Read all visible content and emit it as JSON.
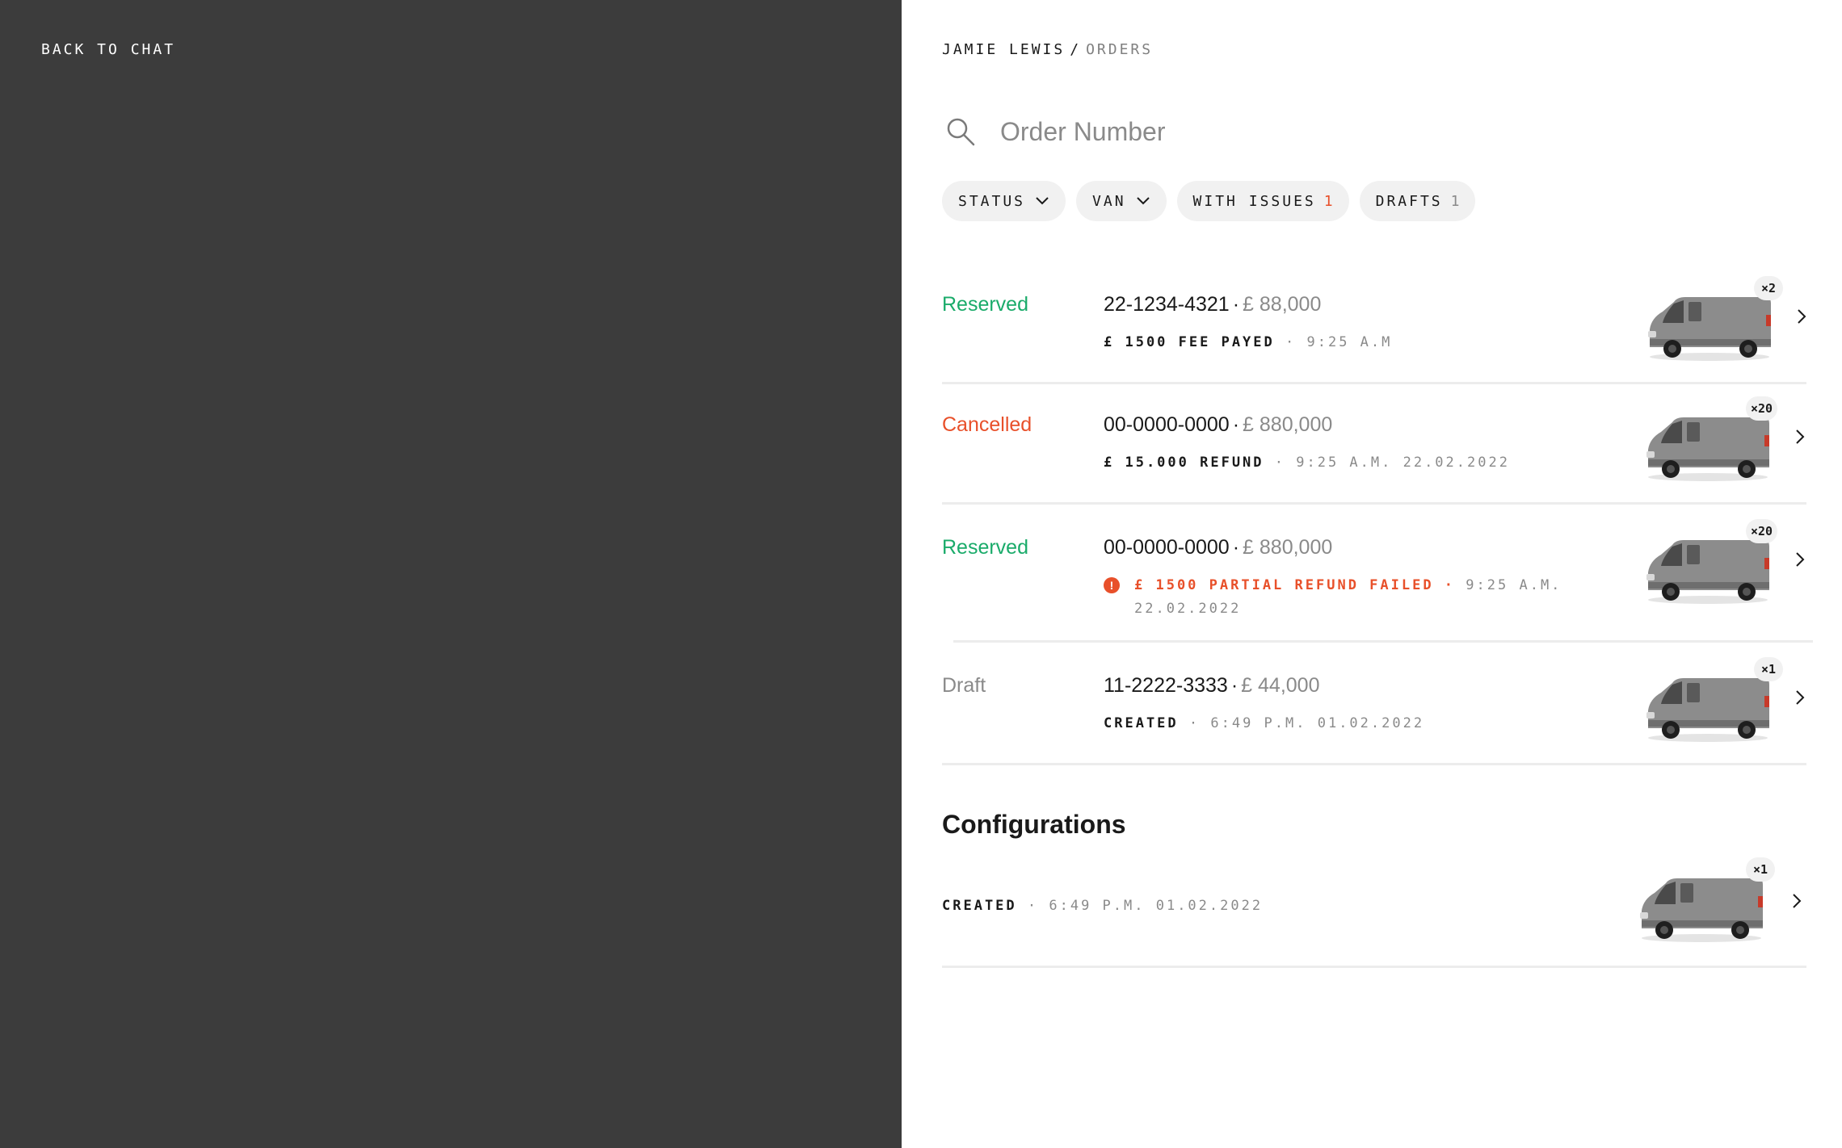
{
  "left": {
    "back_label": "BACK TO CHAT"
  },
  "breadcrumb": {
    "user": "JAMIE LEWIS",
    "separator": "/",
    "current": "ORDERS"
  },
  "search": {
    "placeholder": "Order Number",
    "value": ""
  },
  "filters": [
    {
      "label": "STATUS",
      "dropdown": true
    },
    {
      "label": "VAN",
      "dropdown": true
    },
    {
      "label": "WITH ISSUES",
      "count": "1",
      "count_color": "#e8502a"
    },
    {
      "label": "DRAFTS",
      "count": "1",
      "count_color": "#8a8a8a"
    }
  ],
  "orders": [
    {
      "status": "Reserved",
      "status_color": "#1aab6a",
      "number": "22-1234-4321",
      "price": "£ 88,000",
      "detail_strong": "£ 1500 FEE PAYED",
      "detail_muted": "· 9:25 A.M",
      "quantity": "×2"
    },
    {
      "status": "Cancelled",
      "status_color": "#e8502a",
      "number": "00-0000-0000",
      "price": "£ 880,000",
      "detail_strong": "£ 15.000 REFUND",
      "detail_muted": "· 9:25 A.M. 22.02.2022",
      "quantity": "×20"
    },
    {
      "status": "Reserved",
      "status_color": "#1aab6a",
      "number": "00-0000-0000",
      "price": "£ 880,000",
      "issue": "£ 1500 PARTIAL REFUND FAILED ·",
      "detail_muted_line1": "9:25 A.M.",
      "detail_muted_line2": "22.02.2022",
      "quantity": "×20"
    },
    {
      "status": "Draft",
      "status_color": "#8a8a8a",
      "number": "11-2222-3333",
      "price": "£ 44,000",
      "detail_strong": "CREATED",
      "detail_muted": "· 6:49 P.M. 01.02.2022",
      "quantity": "×1"
    }
  ],
  "configurations": {
    "title": "Configurations",
    "items": [
      {
        "detail_strong": "CREATED",
        "detail_muted": "· 6:49 P.M. 01.02.2022",
        "quantity": "×1"
      }
    ]
  },
  "icons": {
    "search": "search-icon",
    "chevron_down": "chevron-down-icon",
    "chevron_right": "chevron-right-icon",
    "warning": "alert-icon",
    "van": "van-image"
  },
  "colors": {
    "left_panel": "#3c3c3c",
    "accent_green": "#1aab6a",
    "accent_orange": "#e8502a",
    "muted": "#8a8a8a"
  }
}
